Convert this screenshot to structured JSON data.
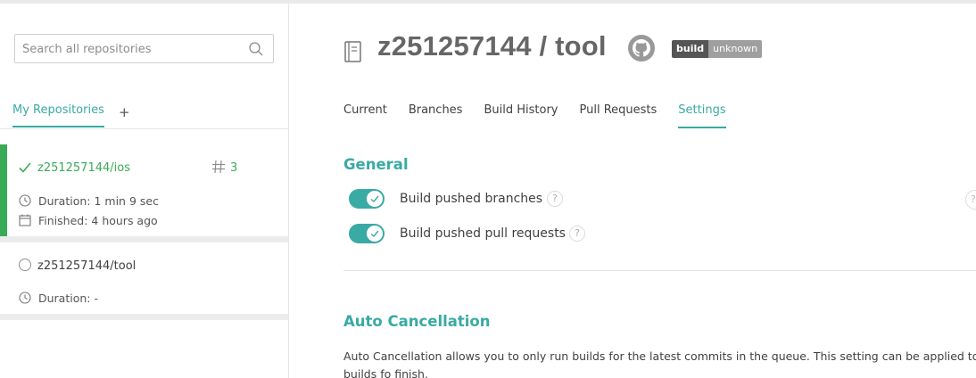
{
  "search": {
    "placeholder": "Search all repositories"
  },
  "sidebar": {
    "tabs": {
      "mine": "My Repositories",
      "add": "+"
    },
    "repos": [
      {
        "name": "z251257144/ios",
        "build_number": "3",
        "duration": "Duration: 1 min 9 sec",
        "finished": "Finished: 4 hours ago",
        "status": "passed",
        "status_color": "#39aa56"
      },
      {
        "name": "z251257144/tool",
        "duration": "Duration: -",
        "status": "none"
      }
    ]
  },
  "header": {
    "title": "z251257144 / tool",
    "badge_left": "build",
    "badge_right": "unknown"
  },
  "tabs": [
    {
      "label": "Current"
    },
    {
      "label": "Branches"
    },
    {
      "label": "Build History"
    },
    {
      "label": "Pull Requests"
    },
    {
      "label": "Settings",
      "active": true
    }
  ],
  "settings": {
    "general_title": "General",
    "options": [
      {
        "label": "Build pushed branches",
        "enabled": true
      },
      {
        "label": "Build pushed pull requests",
        "enabled": true
      }
    ],
    "help_glyph": "?",
    "auto_cancel_title": "Auto Cancellation",
    "auto_cancel_desc": "Auto Cancellation allows you to only run builds for the latest commits in the queue. This setting can be applied to builds fo finish."
  },
  "colors": {
    "accent": "#39aaa4",
    "passed": "#39aa56",
    "badge_dark": "#555555",
    "badge_grey": "#9f9f9f"
  }
}
